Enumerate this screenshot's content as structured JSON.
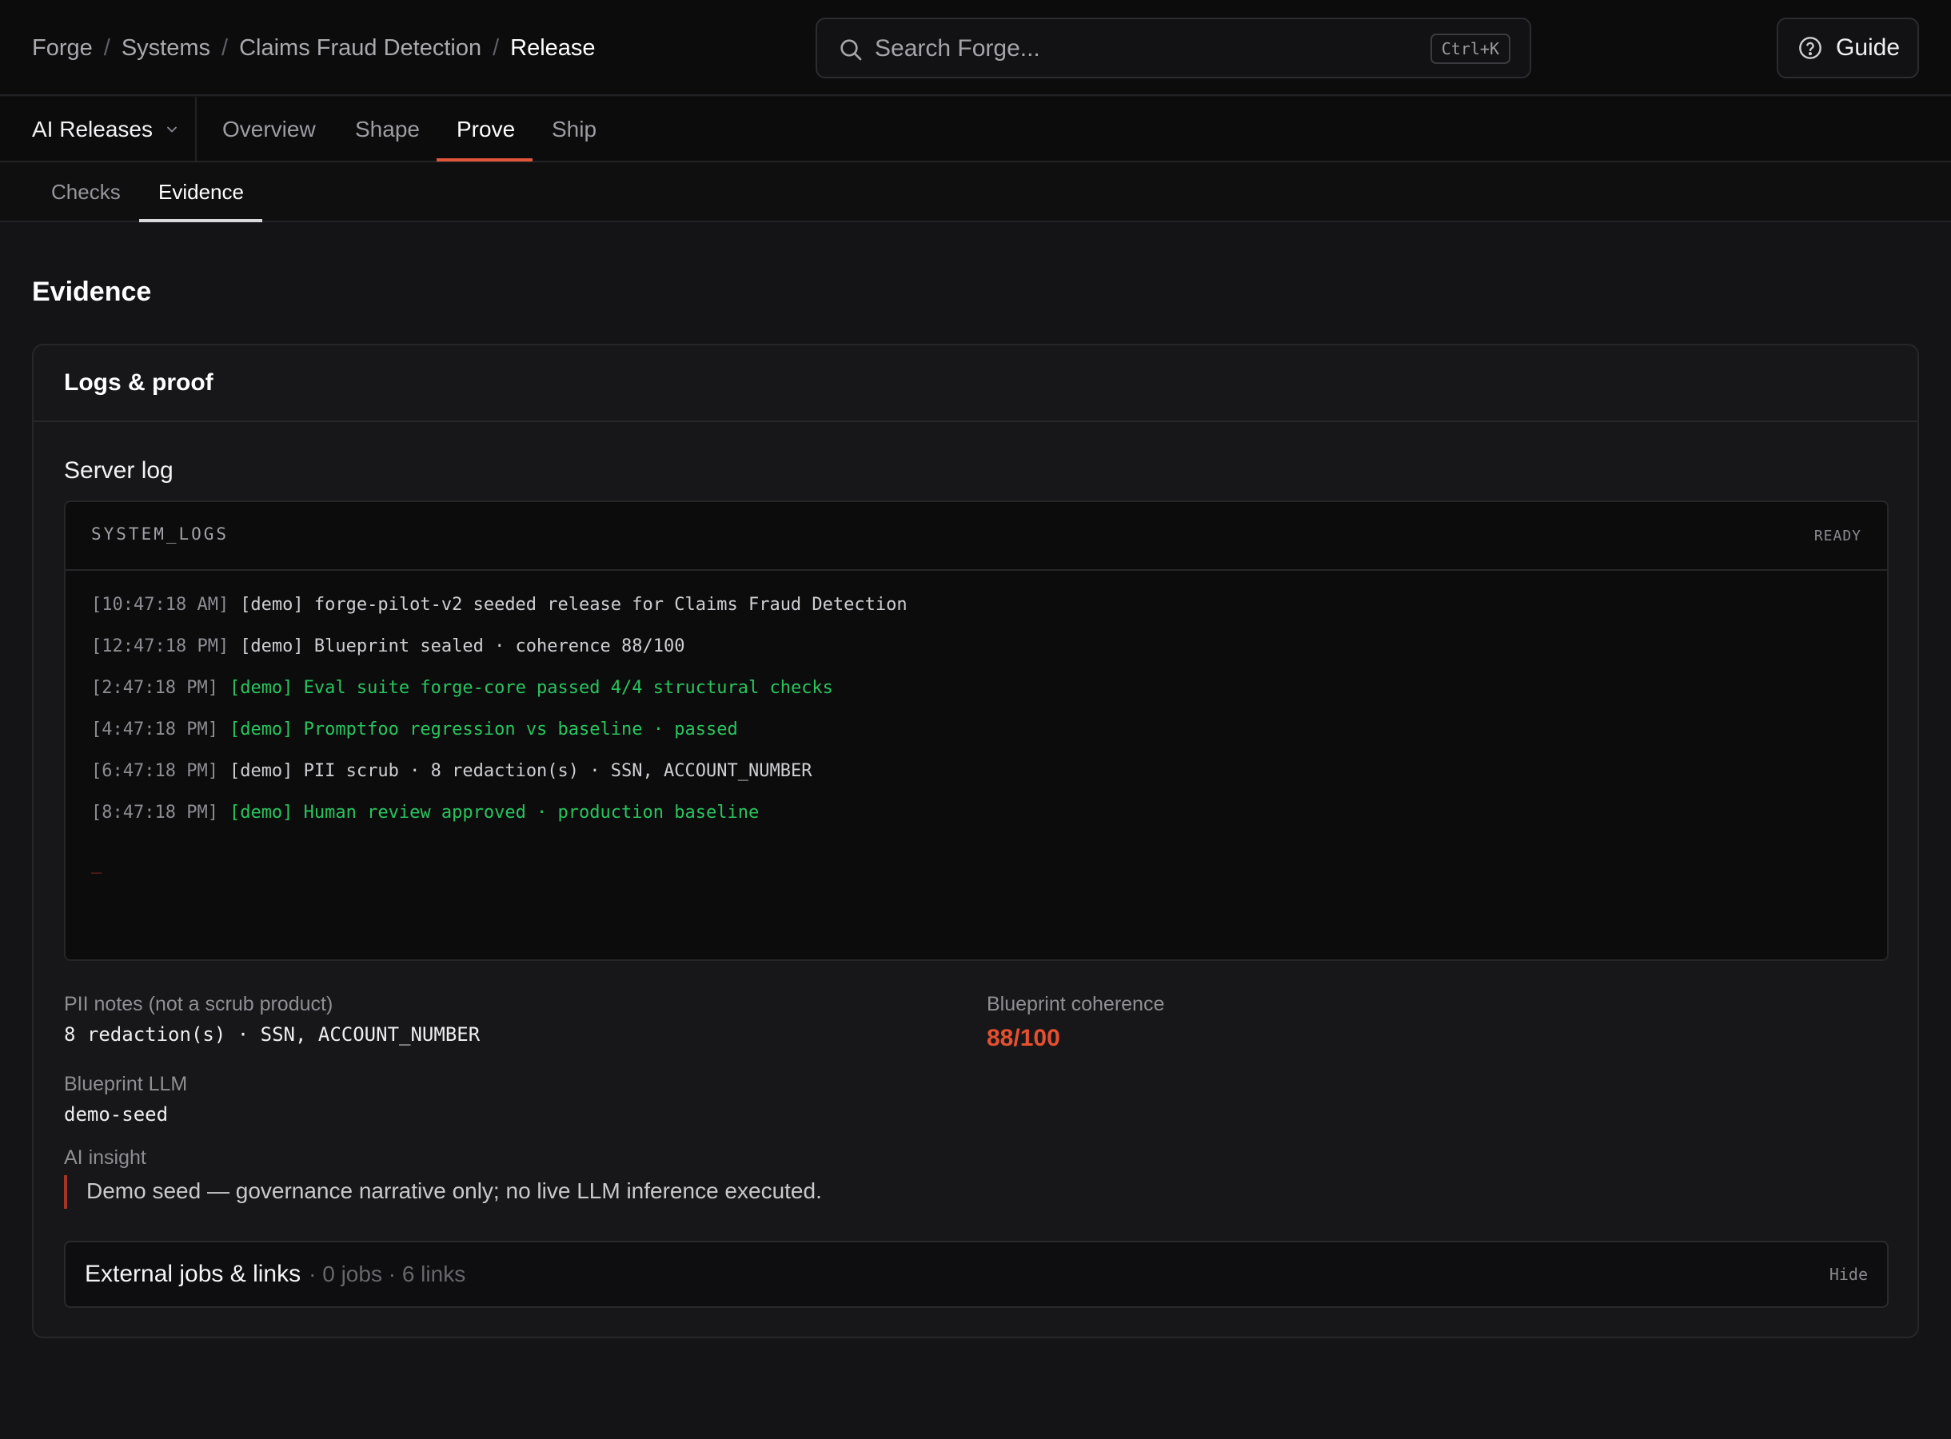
{
  "breadcrumb": {
    "items": [
      "Forge",
      "Systems",
      "Claims Fraud Detection"
    ],
    "current": "Release",
    "separator": "/"
  },
  "search": {
    "placeholder": "Search Forge...",
    "shortcut": "Ctrl+K",
    "icon": "search-icon"
  },
  "guide": {
    "label": "Guide",
    "icon": "help-circle-icon"
  },
  "nav": {
    "product": "AI Releases",
    "product_icon": "chevron-down-icon",
    "tabs": [
      "Overview",
      "Shape",
      "Prove",
      "Ship"
    ],
    "active_tab": "Prove"
  },
  "subnav": {
    "tabs": [
      "Checks",
      "Evidence"
    ],
    "active_tab": "Evidence"
  },
  "page": {
    "title": "Evidence"
  },
  "card": {
    "title": "Logs & proof",
    "server_log": {
      "title": "Server log",
      "label": "SYSTEM_LOGS",
      "status": "READY",
      "cursor": "_",
      "lines": [
        {
          "time": "[10:47:18 AM]",
          "message": "[demo] forge-pilot-v2 seeded release for Claims Fraud Detection",
          "level": "info"
        },
        {
          "time": "[12:47:18 PM]",
          "message": "[demo] Blueprint sealed · coherence 88/100",
          "level": "info"
        },
        {
          "time": "[2:47:18 PM]",
          "message": "[demo] Eval suite forge-core passed 4/4 structural checks",
          "level": "success"
        },
        {
          "time": "[4:47:18 PM]",
          "message": "[demo] Promptfoo regression vs baseline · passed",
          "level": "success"
        },
        {
          "time": "[6:47:18 PM]",
          "message": "[demo] PII scrub · 8 redaction(s) · SSN, ACCOUNT_NUMBER",
          "level": "info"
        },
        {
          "time": "[8:47:18 PM]",
          "message": "[demo] Human review approved · production baseline",
          "level": "success"
        }
      ]
    },
    "pii": {
      "label": "PII notes (not a scrub product)",
      "value": "8 redaction(s) · SSN, ACCOUNT_NUMBER"
    },
    "coherence": {
      "label": "Blueprint coherence",
      "value": "88/100",
      "color": "#e5502f"
    },
    "llm": {
      "label": "Blueprint LLM",
      "value": "demo-seed"
    },
    "insight": {
      "label": "AI insight",
      "text": "Demo seed — governance narrative only; no live LLM inference executed."
    },
    "external": {
      "title": "External jobs & links",
      "meta": "· 0 jobs · 6 links",
      "toggle": "Hide"
    }
  },
  "colors": {
    "accent": "#e2573a",
    "success": "#28c45e",
    "background": "#141416"
  }
}
